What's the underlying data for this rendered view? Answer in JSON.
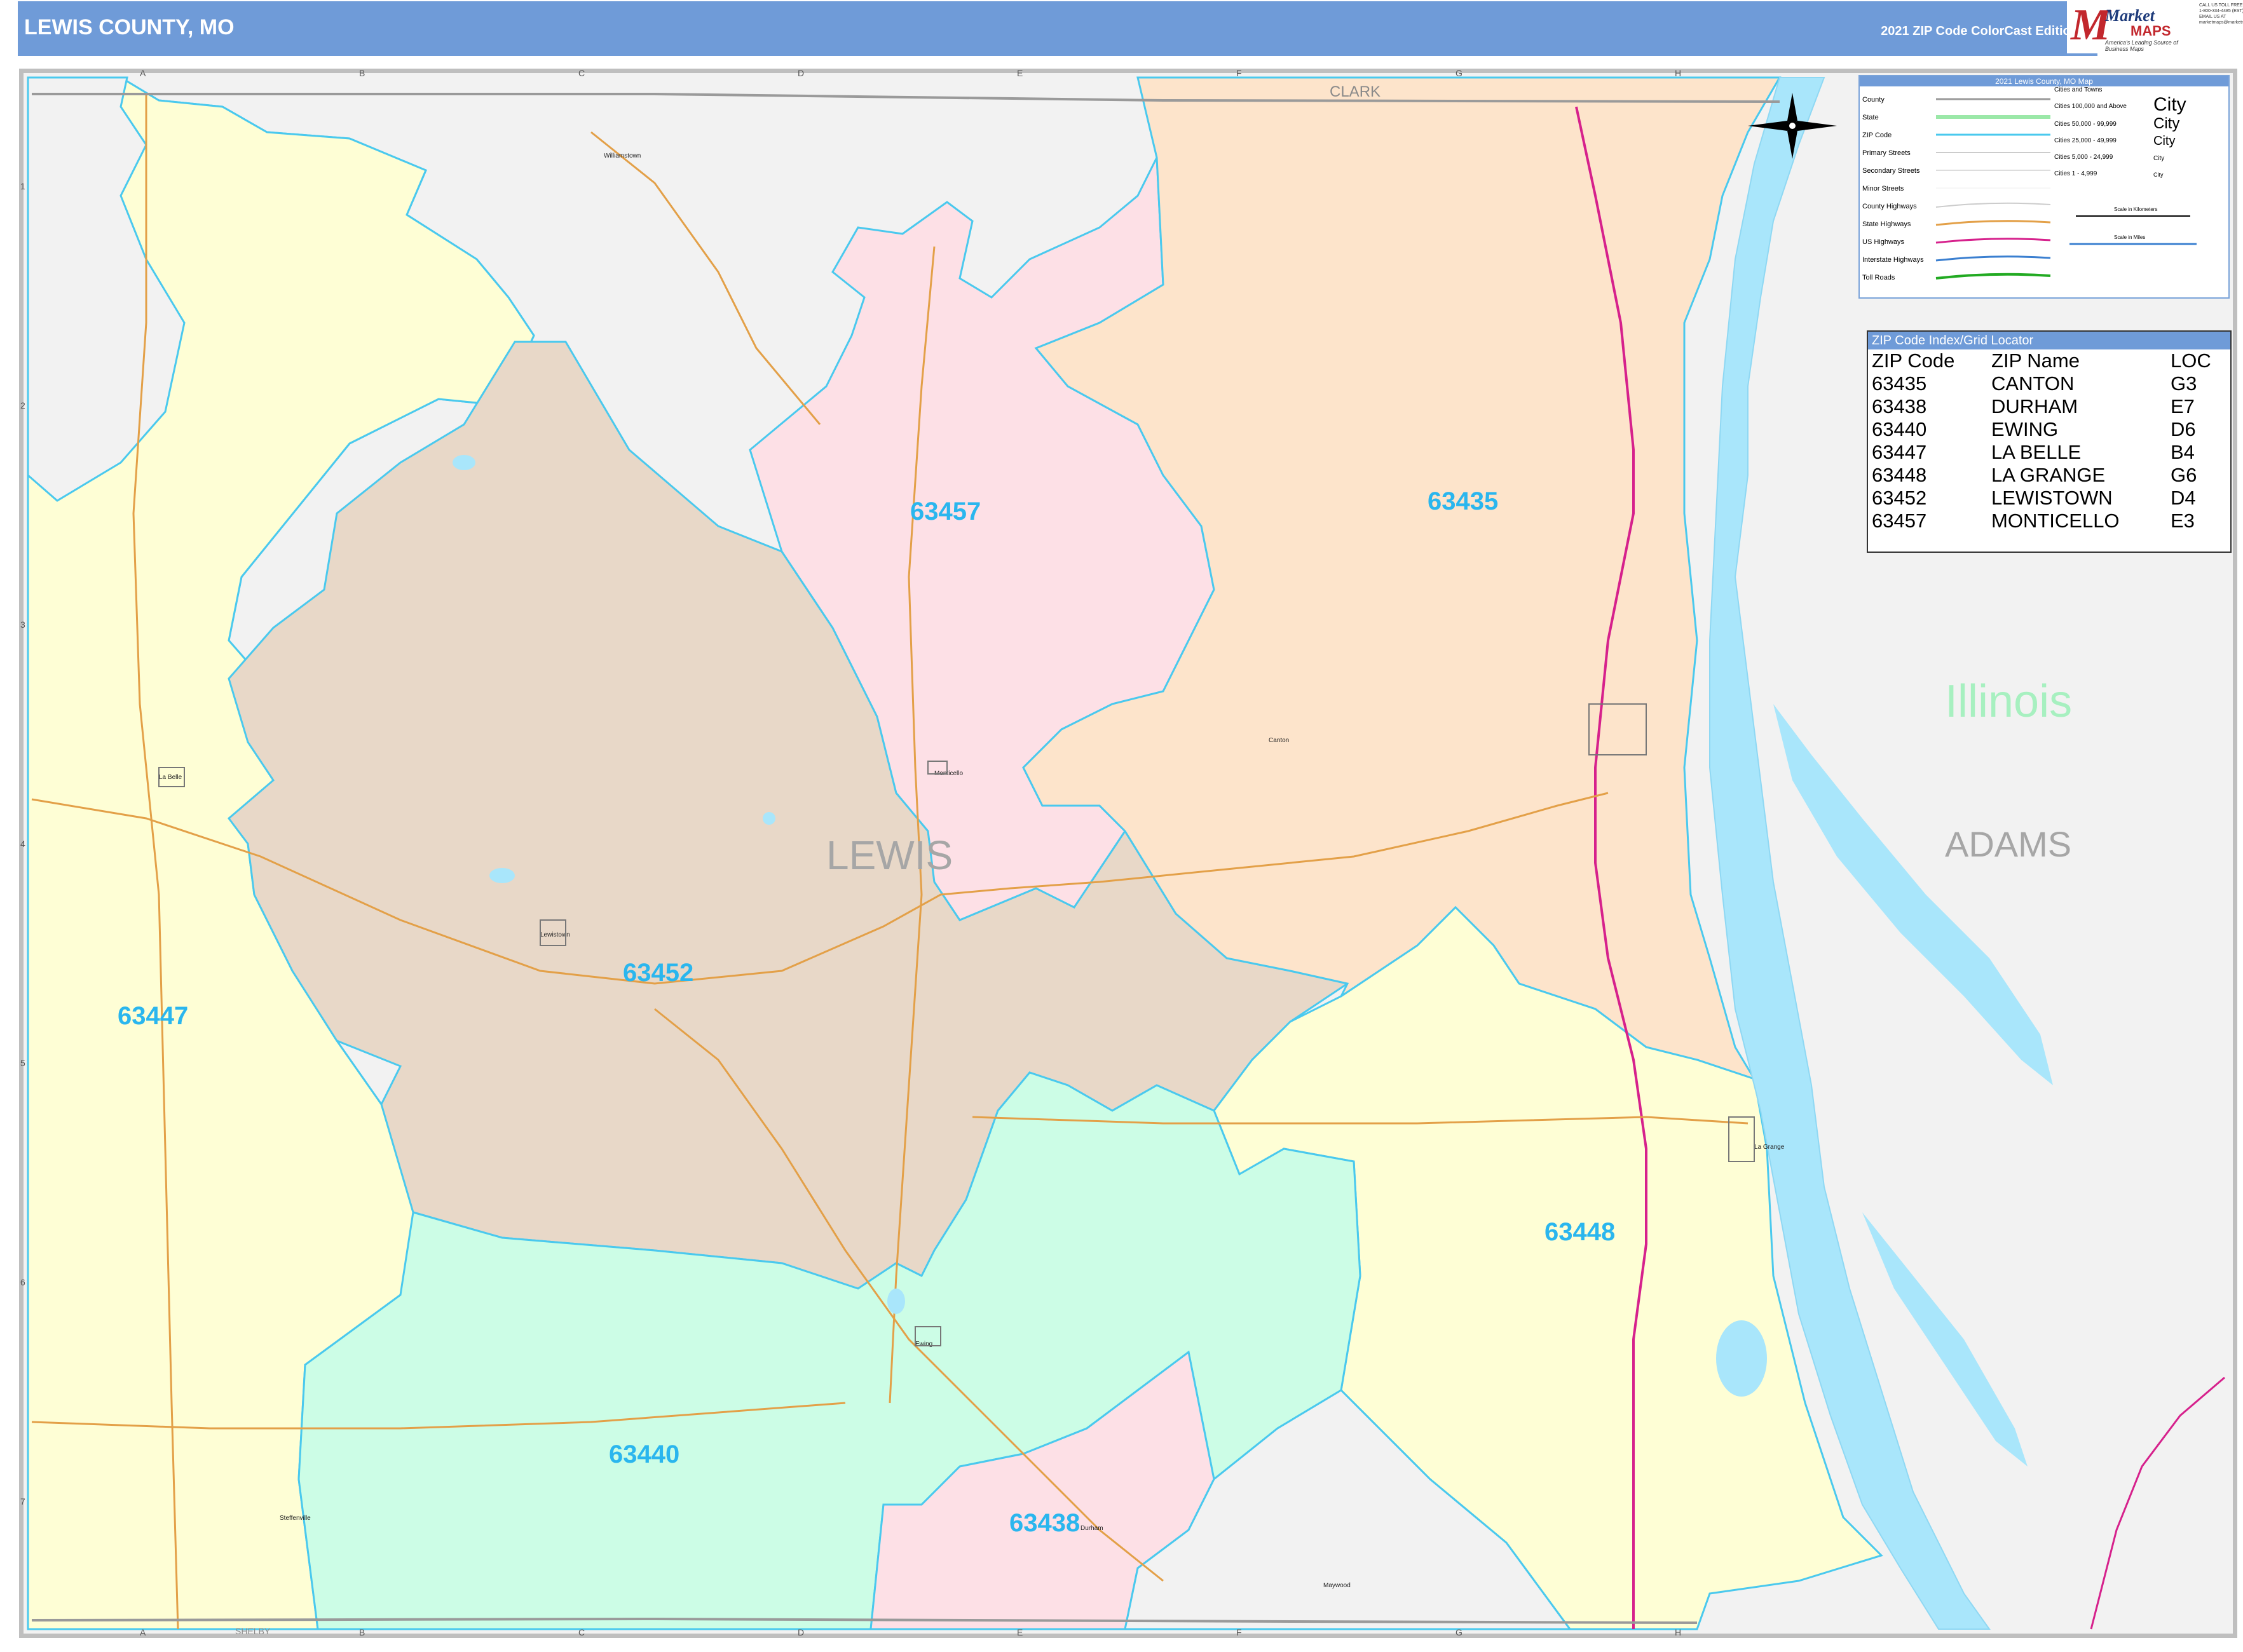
{
  "header": {
    "title": "LEWIS COUNTY, MO",
    "edition": "2021 ZIP Code ColorCast Edition"
  },
  "logo": {
    "brand_top": "Market",
    "brand_bottom": "MAPS",
    "tagline": "America's Leading Source of Business Maps",
    "contact": [
      "CALL US TOLL FREE",
      "1-800-334-4485 (EST)",
      "EMAIL US AT",
      "marketmaps@marketmaps.com"
    ]
  },
  "map": {
    "county_label": "LEWIS",
    "neighbors": {
      "north": "CLARK",
      "east_county": "ADAMS",
      "east_state": "Illinois",
      "south": "SHELBY"
    },
    "grid_columns": [
      "A",
      "B",
      "C",
      "D",
      "E",
      "F",
      "G",
      "H"
    ],
    "grid_rows": [
      "1",
      "2",
      "3",
      "4",
      "5",
      "6",
      "7"
    ],
    "zip_labels": [
      "63457",
      "63435",
      "63452",
      "63447",
      "63448",
      "63440",
      "63438"
    ],
    "towns": [
      "Williamstown",
      "Monticello",
      "Canton",
      "La Belle",
      "Lewistown",
      "La Grange",
      "Ewing",
      "Durham",
      "Steffenville",
      "Maywood"
    ],
    "colors": {
      "63435": "#fde4cb",
      "63438": "#fde0e6",
      "63440": "#ccfde6",
      "63447": "#fefed5",
      "63448": "#fefed5",
      "63452": "#e8d8c8",
      "63457": "#fde0e6",
      "outside": "#f2f2f2",
      "river": "#a9e6fb",
      "zip_boundary": "#4ac9ee",
      "zip_label": "#2ab6ee"
    }
  },
  "legend": {
    "title": "2021 Lewis County, MO Map",
    "items": [
      "County",
      "State",
      "ZIP Code",
      "Primary Streets",
      "Secondary Streets",
      "Minor Streets",
      "County Highways",
      "State Highways",
      "US Highways",
      "Interstate Highways",
      "Toll Roads"
    ],
    "cities_header": "Cities and Towns",
    "cities": [
      {
        "range": "Cities 100,000 and Above",
        "sample": "City"
      },
      {
        "range": "Cities 50,000 - 99,999",
        "sample": "City"
      },
      {
        "range": "Cities 25,000 - 49,999",
        "sample": "City"
      },
      {
        "range": "Cities 5,000 - 24,999",
        "sample": "City"
      },
      {
        "range": "Cities 1 - 4,999",
        "sample": "City"
      }
    ],
    "scale_km": "Scale in Kilometers",
    "scale_mi": "Scale in Miles"
  },
  "zip_index": {
    "title": "ZIP Code Index/Grid Locator",
    "headers": [
      "ZIP Code",
      "ZIP Name",
      "LOC"
    ],
    "rows": [
      [
        "63435",
        "CANTON",
        "G3"
      ],
      [
        "63438",
        "DURHAM",
        "E7"
      ],
      [
        "63440",
        "EWING",
        "D6"
      ],
      [
        "63447",
        "LA BELLE",
        "B4"
      ],
      [
        "63448",
        "LA GRANGE",
        "G6"
      ],
      [
        "63452",
        "LEWISTOWN",
        "D4"
      ],
      [
        "63457",
        "MONTICELLO",
        "E3"
      ]
    ]
  }
}
